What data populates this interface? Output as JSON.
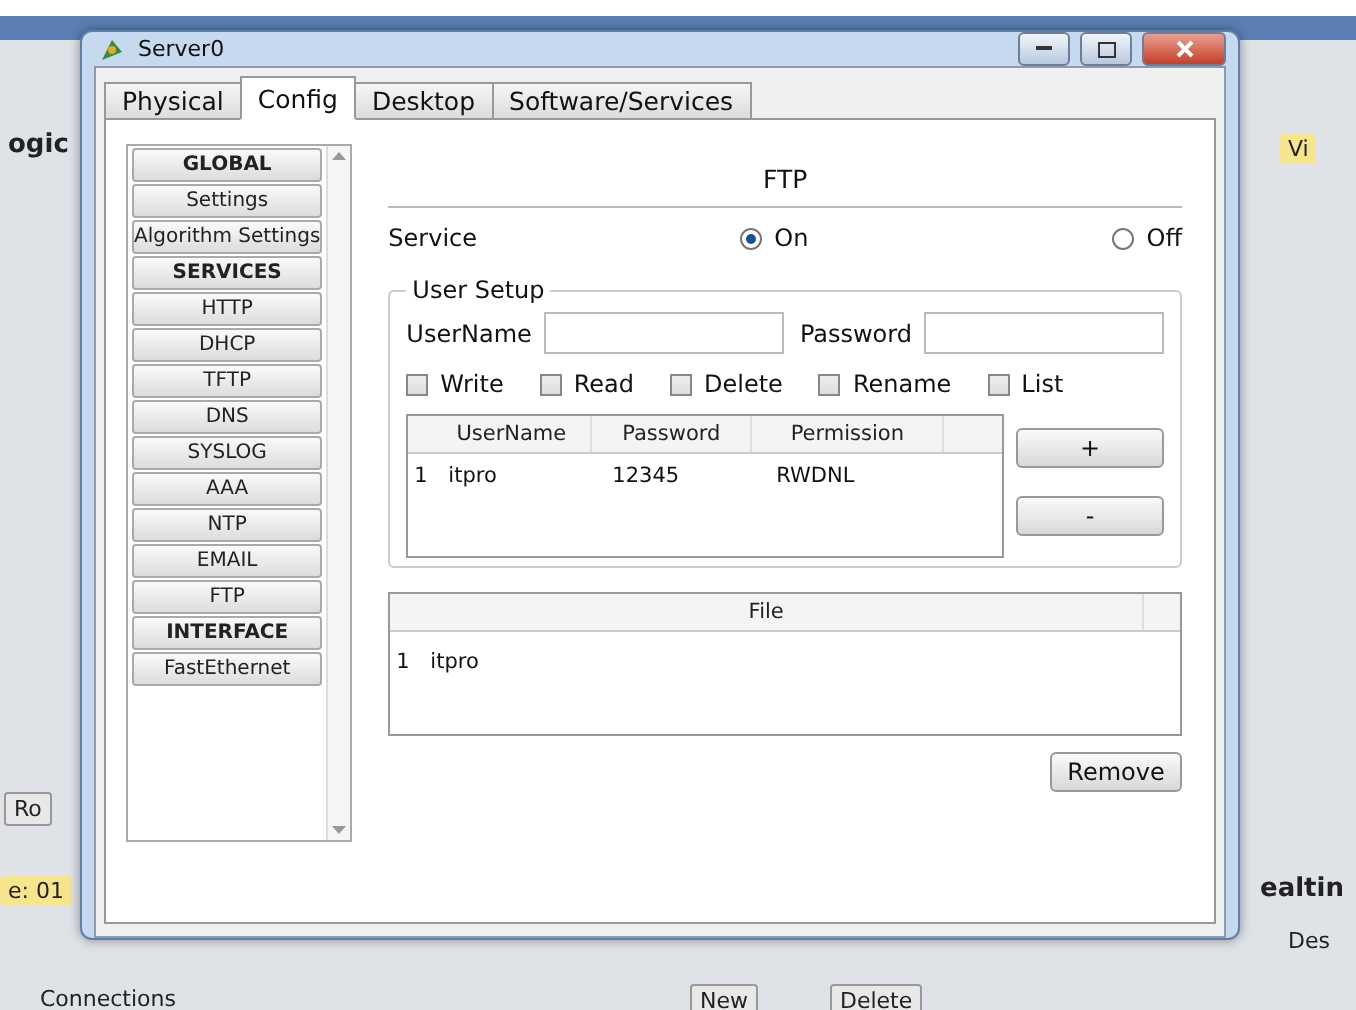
{
  "background": {
    "labels": [
      {
        "text": "ogic",
        "kind": "heading"
      },
      {
        "text": "Vi",
        "kind": "tab"
      },
      {
        "text": "Ro",
        "kind": "button"
      },
      {
        "text": "e: 01",
        "kind": "time"
      },
      {
        "text": "ealtin",
        "kind": "heading"
      },
      {
        "text": "Des",
        "kind": "plain"
      },
      {
        "text": "Connections",
        "kind": "plain"
      },
      {
        "text": "New",
        "kind": "button"
      },
      {
        "text": "Delete",
        "kind": "button"
      }
    ]
  },
  "window": {
    "title": "Server0"
  },
  "tabs": [
    {
      "label": "Physical",
      "selected": false
    },
    {
      "label": "Config",
      "selected": true
    },
    {
      "label": "Desktop",
      "selected": false
    },
    {
      "label": "Software/Services",
      "selected": false
    }
  ],
  "sidebar": {
    "items": [
      {
        "label": "GLOBAL",
        "kind": "header"
      },
      {
        "label": "Settings",
        "kind": "item"
      },
      {
        "label": "Algorithm Settings",
        "kind": "item"
      },
      {
        "label": "SERVICES",
        "kind": "header"
      },
      {
        "label": "HTTP",
        "kind": "item"
      },
      {
        "label": "DHCP",
        "kind": "item"
      },
      {
        "label": "TFTP",
        "kind": "item"
      },
      {
        "label": "DNS",
        "kind": "item"
      },
      {
        "label": "SYSLOG",
        "kind": "item"
      },
      {
        "label": "AAA",
        "kind": "item"
      },
      {
        "label": "NTP",
        "kind": "item"
      },
      {
        "label": "EMAIL",
        "kind": "item"
      },
      {
        "label": "FTP",
        "kind": "item"
      },
      {
        "label": "INTERFACE",
        "kind": "header"
      },
      {
        "label": "FastEthernet",
        "kind": "item"
      }
    ]
  },
  "ftp": {
    "title": "FTP",
    "service": {
      "label": "Service",
      "options": [
        {
          "label": "On",
          "selected": true
        },
        {
          "label": "Off",
          "selected": false
        }
      ]
    },
    "user_setup": {
      "title": "User Setup",
      "username_label": "UserName",
      "password_label": "Password",
      "permissions": [
        {
          "label": "Write",
          "checked": false
        },
        {
          "label": "Read",
          "checked": false
        },
        {
          "label": "Delete",
          "checked": false
        },
        {
          "label": "Rename",
          "checked": false
        },
        {
          "label": "List",
          "checked": false
        }
      ],
      "table": {
        "columns": [
          "UserName",
          "Password",
          "Permission"
        ],
        "rows": [
          {
            "index": "1",
            "cells": [
              "itpro",
              "12345",
              "RWDNL"
            ]
          }
        ]
      },
      "add_button": "+",
      "remove_button": "-"
    },
    "files": {
      "column": "File",
      "rows": [
        {
          "index": "1",
          "name": "itpro"
        }
      ]
    },
    "remove_button": "Remove"
  }
}
